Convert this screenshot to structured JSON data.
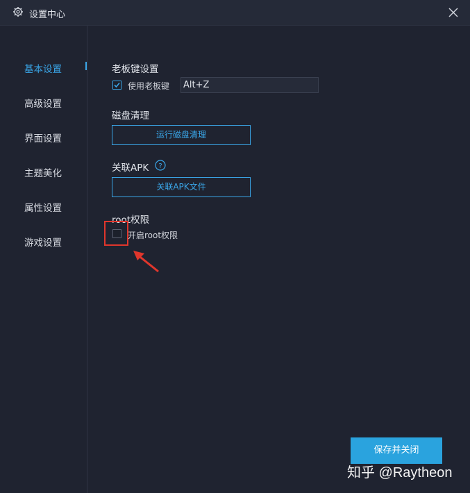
{
  "window": {
    "title": "设置中心"
  },
  "sidebar": {
    "items": [
      {
        "label": "基本设置",
        "active": true
      },
      {
        "label": "高级设置"
      },
      {
        "label": "界面设置"
      },
      {
        "label": "主题美化"
      },
      {
        "label": "属性设置"
      },
      {
        "label": "游戏设置"
      }
    ]
  },
  "boss_key": {
    "title": "老板键设置",
    "checkbox_label": "使用老板键",
    "checked": true,
    "hotkey_value": "Alt+Z"
  },
  "disk": {
    "title": "磁盘清理",
    "button_label": "运行磁盘清理"
  },
  "apk": {
    "title": "关联APK",
    "button_label": "关联APK文件"
  },
  "root": {
    "title": "root权限",
    "checkbox_label": "开启root权限",
    "checked": false
  },
  "footer": {
    "save_label": "保存并关闭"
  },
  "watermark": "知乎 @Raytheon",
  "colors": {
    "accent": "#3aa6e8",
    "annotation": "#e0362c",
    "background": "#1f2330"
  }
}
